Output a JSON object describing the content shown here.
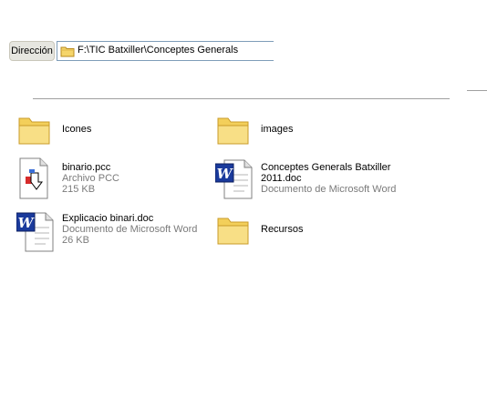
{
  "address_bar": {
    "label": "Dirección",
    "path": "F:\\TIC Batxiller\\Conceptes Generals"
  },
  "items": [
    {
      "name": "Icones",
      "line2": "",
      "type": "",
      "size": "",
      "icon": "folder-icon"
    },
    {
      "name": "images",
      "line2": "",
      "type": "",
      "size": "",
      "icon": "folder-icon"
    },
    {
      "name": "binario.pcc",
      "line2": "",
      "type": "Archivo PCC",
      "size": "215 KB",
      "icon": "pcc-file-icon"
    },
    {
      "name": "Conceptes Generals Batxiller",
      "line2": "2011.doc",
      "type": "Documento de Microsoft Word",
      "size": "",
      "icon": "word-document-icon"
    },
    {
      "name": "Explicacio binari.doc",
      "line2": "",
      "type": "Documento de Microsoft Word",
      "size": "26 KB",
      "icon": "word-document-icon"
    },
    {
      "name": "Recursos",
      "line2": "",
      "type": "",
      "size": "",
      "icon": "folder-icon"
    }
  ]
}
